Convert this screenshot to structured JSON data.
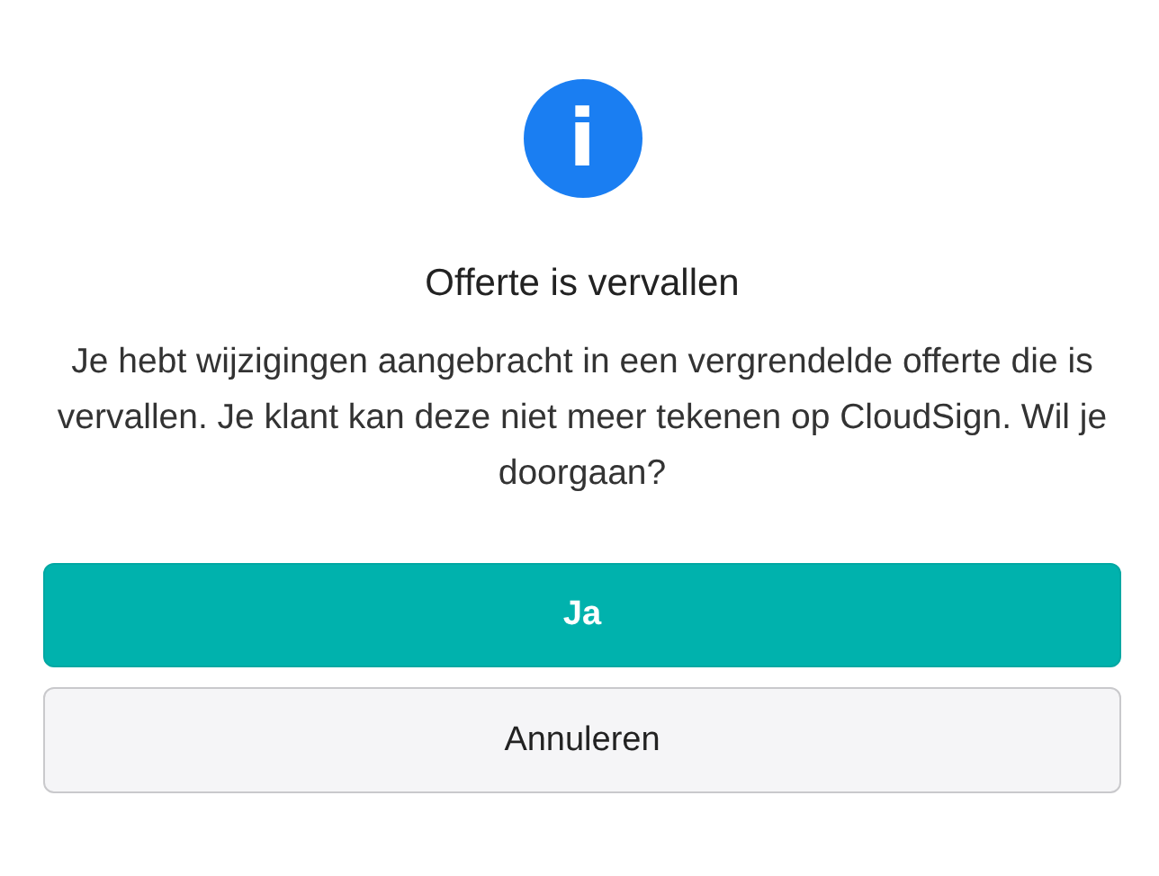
{
  "dialog": {
    "icon": "i",
    "title": "Offerte is vervallen",
    "message": "Je hebt wijzigingen aangebracht in een vergrendelde offerte die is vervallen. Je klant kan deze niet meer tekenen op CloudSign. Wil je doorgaan?",
    "buttons": [
      {
        "label": "Ja",
        "kind": "primary"
      },
      {
        "label": "Annuleren",
        "kind": "secondary"
      }
    ]
  }
}
